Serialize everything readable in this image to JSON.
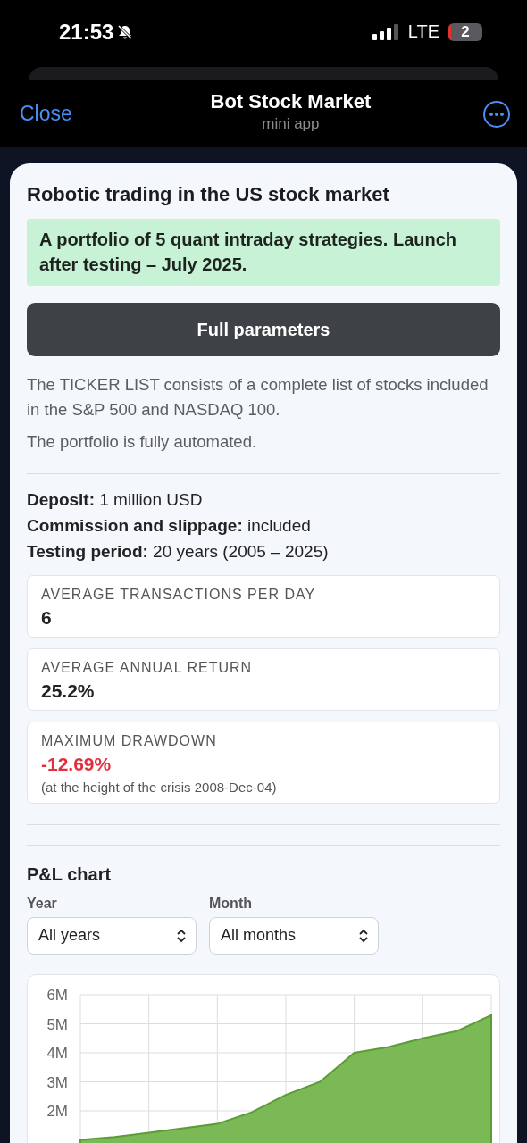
{
  "status_bar": {
    "time": "21:53",
    "network": "LTE",
    "battery": "2"
  },
  "header": {
    "close": "Close",
    "title": "Bot Stock Market",
    "subtitle": "mini app"
  },
  "content": {
    "title": "Robotic trading in the US stock market",
    "banner": "A portfolio of 5 quant intraday strategies. Launch after testing – July 2025.",
    "button": "Full parameters",
    "paragraphs": [
      "The TICKER LIST consists of a complete list of stocks included in the S&P 500 and NASDAQ 100.",
      "The portfolio is fully automated."
    ],
    "facts": [
      "**Deposit:** 1 million USD",
      "**Commission and slippage:** included",
      "**Testing period:** 20 years (2005 – 2025)"
    ],
    "stats": [
      {
        "kind": "plain",
        "label": "AVERAGE TRANSACTIONS PER DAY",
        "value": "6"
      },
      {
        "kind": "plain",
        "label": "AVERAGE ANNUAL RETURN",
        "value": "25.2%"
      },
      {
        "kind": "negative",
        "label": "MAXIMUM DRAWDOWN",
        "value": "-12.69%",
        "note": "(at the height of the crisis 2008-Dec-04)"
      }
    ]
  },
  "chart_section": {
    "title": "P&L chart",
    "filters": [
      {
        "label": "Year",
        "value": "All years"
      },
      {
        "label": "Month",
        "value": "All months"
      }
    ],
    "chart_data": {
      "type": "area",
      "grid": true,
      "series": [
        {
          "color": "#7ab955",
          "values": [
            1000000,
            1100000,
            1250000,
            1400000,
            1550000,
            1950000,
            2550000,
            3000000,
            4000000,
            4200000,
            4500000,
            4750000,
            5300000
          ]
        }
      ],
      "ylim": [
        0,
        6000000
      ],
      "yticks": [
        {
          "value": 2000000,
          "label": "2M"
        },
        {
          "value": 3000000,
          "label": "3M"
        },
        {
          "value": 4000000,
          "label": "4M"
        },
        {
          "value": 5000000,
          "label": "5M"
        },
        {
          "value": 6000000,
          "label": "6M"
        }
      ]
    }
  }
}
